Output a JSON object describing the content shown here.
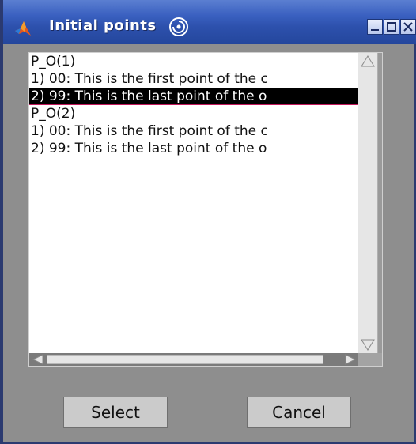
{
  "window": {
    "title": "Initial  points"
  },
  "list": {
    "items": [
      {
        "text": "P_O(1)",
        "selected": false
      },
      {
        "text": "1) 00: This is the first point of the c",
        "selected": false
      },
      {
        "text": "2) 99: This is the last point of the o",
        "selected": true
      },
      {
        "text": "P_O(2)",
        "selected": false
      },
      {
        "text": "1) 00: This is the first point of the c",
        "selected": false
      },
      {
        "text": "2) 99: This is the last point of the o",
        "selected": false
      }
    ]
  },
  "buttons": {
    "select_label": "Select",
    "cancel_label": "Cancel"
  },
  "icons": {
    "app": "matlab-logo-icon",
    "title_decoration": "swirl-icon",
    "minimize": "minimize-icon",
    "maximize": "maximize-icon",
    "close": "close-icon"
  },
  "colors": {
    "titlebar": "#2d51ad",
    "selection": "#000000",
    "selection_border": "#c2185b",
    "window_bg": "#8e8e8e"
  }
}
